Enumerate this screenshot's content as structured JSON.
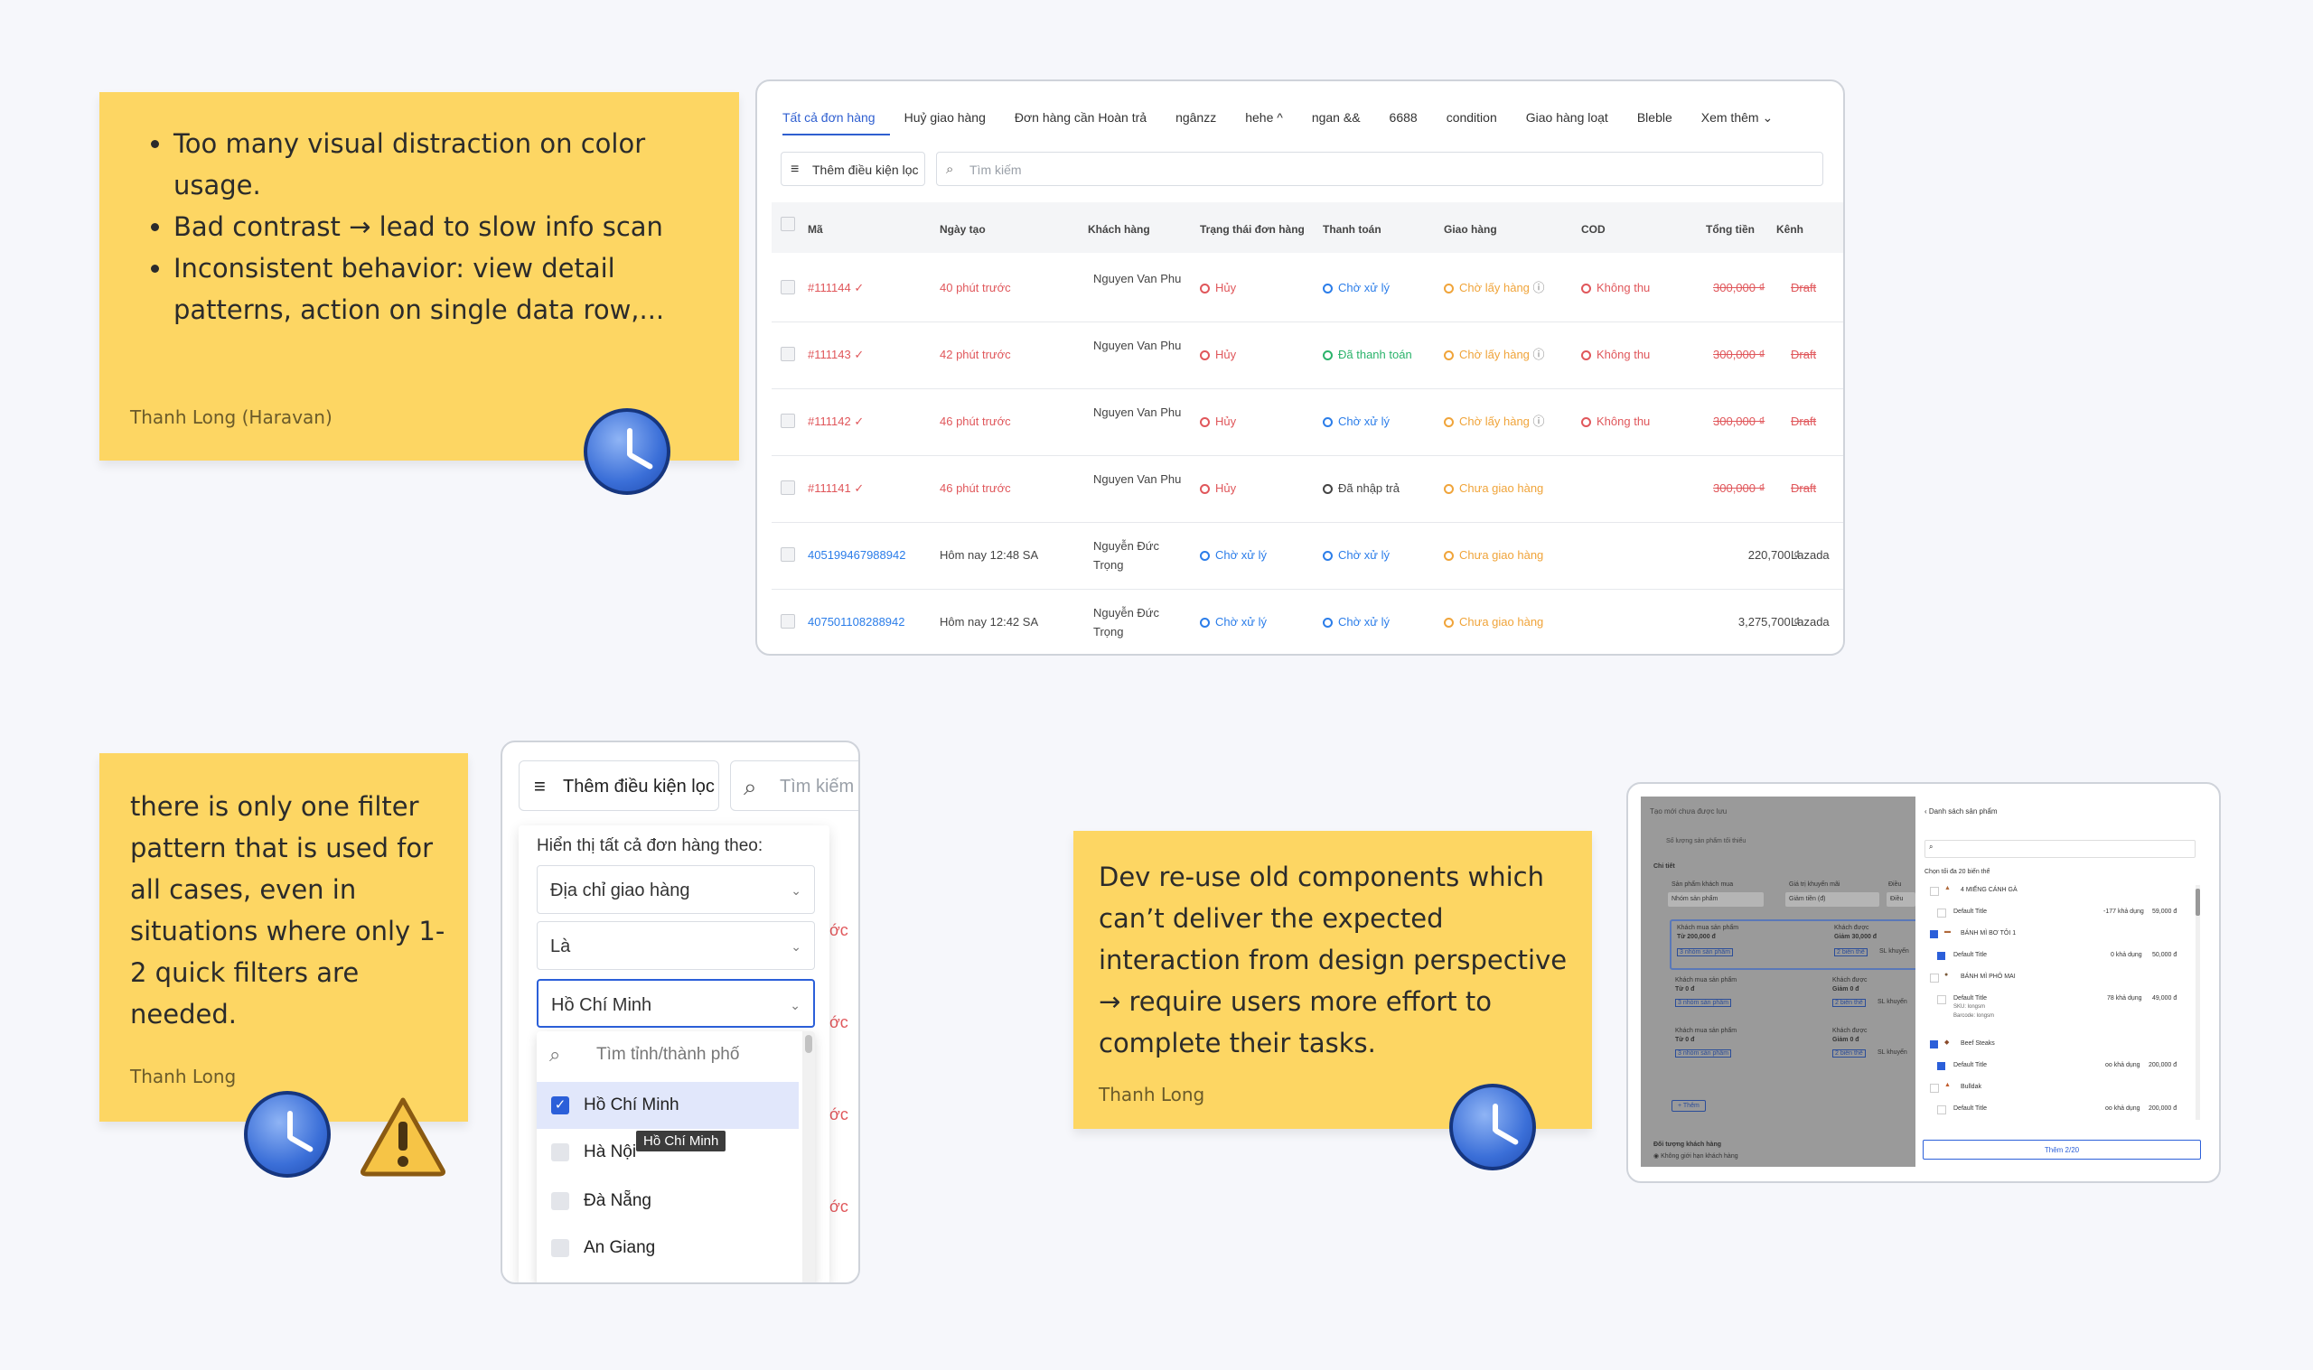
{
  "note1": {
    "bullets": [
      "Too many visual distraction on color usage.",
      "Bad contrast → lead to slow info scan",
      "Inconsistent behavior: view detail patterns, action on single data row,..."
    ],
    "author": "Thanh Long (Haravan)"
  },
  "note2": {
    "text": "there is only one filter pattern that is used for all cases, even in situations where only 1-2 quick filters are needed.",
    "author": "Thanh Long"
  },
  "note3": {
    "text": "Dev re-use old components which can’t deliver the expected interaction from design perspective → require users more effort to complete their tasks.",
    "author": "Thanh Long"
  },
  "orders": {
    "tabs": [
      "Tất cả đơn hàng",
      "Huỷ giao hàng",
      "Đơn hàng cần Hoàn trả",
      "ngânzz",
      "hehe ^",
      "ngan &&",
      "6688",
      "condition",
      "Giao hàng loạt",
      "Bleble",
      "Xem thêm"
    ],
    "filter_label": "Thêm điều kiện lọc",
    "search_placeholder": "Tìm kiếm",
    "columns": [
      "Mã",
      "Ngày tạo",
      "Khách hàng",
      "Trạng thái đơn hàng",
      "Thanh toán",
      "Giao hàng",
      "COD",
      "Tổng tiền",
      "Kênh"
    ],
    "rows": [
      {
        "code": "#111144 ✓",
        "date": "40 phút trước",
        "customer": "Nguyen Van Phu",
        "status": "Hủy",
        "payment": "Chờ xử lý",
        "shipping": "Chờ lấy hàng",
        "cod": "Không thu",
        "total": "300,000 ₫",
        "channel": "Draft"
      },
      {
        "code": "#111143 ✓",
        "date": "42 phút trước",
        "customer": "Nguyen Van Phu",
        "status": "Hủy",
        "payment": "Đã thanh toán",
        "shipping": "Chờ lấy hàng",
        "cod": "Không thu",
        "total": "300,000 ₫",
        "channel": "Draft"
      },
      {
        "code": "#111142 ✓",
        "date": "46 phút trước",
        "customer": "Nguyen Van Phu",
        "status": "Hủy",
        "payment": "Chờ xử lý",
        "shipping": "Chờ lấy hàng",
        "cod": "Không thu",
        "total": "300,000 ₫",
        "channel": "Draft"
      },
      {
        "code": "#111141 ✓",
        "date": "46 phút trước",
        "customer": "Nguyen Van Phu",
        "status": "Hủy",
        "payment": "Đã nhập trả",
        "shipping": "Chưa giao hàng",
        "cod": "",
        "total": "300,000 ₫",
        "channel": "Draft"
      },
      {
        "code": "405199467988942",
        "date": "Hôm nay 12:48 SA",
        "customer": "Nguyễn Đức Trọng",
        "status": "Chờ xử lý",
        "payment": "Chờ xử lý",
        "shipping": "Chưa giao hàng",
        "cod": "",
        "total": "220,700 ₫",
        "channel": "Lazada"
      },
      {
        "code": "407501108288942",
        "date": "Hôm nay 12:42 SA",
        "customer": "Nguyễn Đức Trọng",
        "status": "Chờ xử lý",
        "payment": "Chờ xử lý",
        "shipping": "Chưa giao hàng",
        "cod": "",
        "total": "3,275,700 ₫",
        "channel": "Lazada"
      }
    ]
  },
  "filter": {
    "button_label": "Thêm điều kiện lọc",
    "search_placeholder": "Tìm kiếm",
    "show_all_label": "Hiển thị tất cả đơn hàng theo:",
    "field": "Địa chỉ giao hàng",
    "operator": "Là",
    "value": "Hồ Chí Minh",
    "list_search_placeholder": "Tìm tỉnh/thành phố",
    "options": [
      "Hồ Chí Minh",
      "Hà Nội",
      "Đà Nẵng",
      "An Giang"
    ],
    "tooltip": "Hồ Chí Minh",
    "bg_fragments": [
      "ớc",
      "ớc",
      "ước",
      "ước"
    ]
  },
  "product_modal": {
    "left_title": "Tạo mới chưa được lưu",
    "left_sub": "Số lượng sản phẩm tối thiểu",
    "left_section": "Chi tiết",
    "left_label_a": "Sản phẩm khách mua",
    "left_label_b": "Giá trị khuyến mãi",
    "left_label_c": "Điều",
    "left_select_a": "Nhóm sản phẩm",
    "left_select_b": "Giảm tiền (đ)",
    "left_select_c": "Điều",
    "left_blocks": [
      {
        "a": "Khách mua sản phẩm",
        "b": "Từ 200,000 đ",
        "c": "Khách được",
        "d": "Giảm 30,000 đ",
        "e": "3 nhóm sản phẩm",
        "f": "2 biến thể",
        "g": "SL khuyến"
      },
      {
        "a": "Khách mua sản phẩm",
        "b": "Từ 0 đ",
        "c": "Khách được",
        "d": "Giảm 0 đ",
        "e": "3 nhóm sản phẩm",
        "f": "2 biến thể",
        "g": "SL khuyến"
      },
      {
        "a": "Khách mua sản phẩm",
        "b": "Từ 0 đ",
        "c": "Khách được",
        "d": "Giảm 0 đ",
        "e": "3 nhóm sản phẩm",
        "f": "2 biến thể",
        "g": "SL khuyến"
      }
    ],
    "left_add": "Thêm",
    "left_footer": "Đối tượng khách hàng",
    "left_footer_option": "Không giới hạn khách hàng",
    "right_title": "Danh sách sản phẩm",
    "right_hint": "Chọn tối đa 20 biến thể",
    "right_items": [
      {
        "name": "4 MIẾNG CÁNH GÀ",
        "variant": "Default Title",
        "stock": "-177 khả dụng",
        "price": "59,000 đ",
        "sku": "",
        "barcode": ""
      },
      {
        "name": "BÁNH MÌ BƠ TỎI 1",
        "variant": "Default Title",
        "stock": "0 khả dụng",
        "price": "50,000 đ",
        "sku": "",
        "barcode": ""
      },
      {
        "name": "BÁNH MÌ PHÔ MAI",
        "variant": "Default Title",
        "stock": "78 khả dụng",
        "price": "49,000 đ",
        "sku": "SKU: longsm",
        "barcode": "Barcode: longsm"
      },
      {
        "name": "Beef Steaks",
        "variant": "Default Title",
        "stock": "oo khả dụng",
        "price": "200,000 đ",
        "sku": "",
        "barcode": ""
      },
      {
        "name": "Bulldak",
        "variant": "Default Title",
        "stock": "oo khả dụng",
        "price": "200,000 đ",
        "sku": "",
        "barcode": ""
      }
    ],
    "right_button": "Thêm 2/20"
  }
}
